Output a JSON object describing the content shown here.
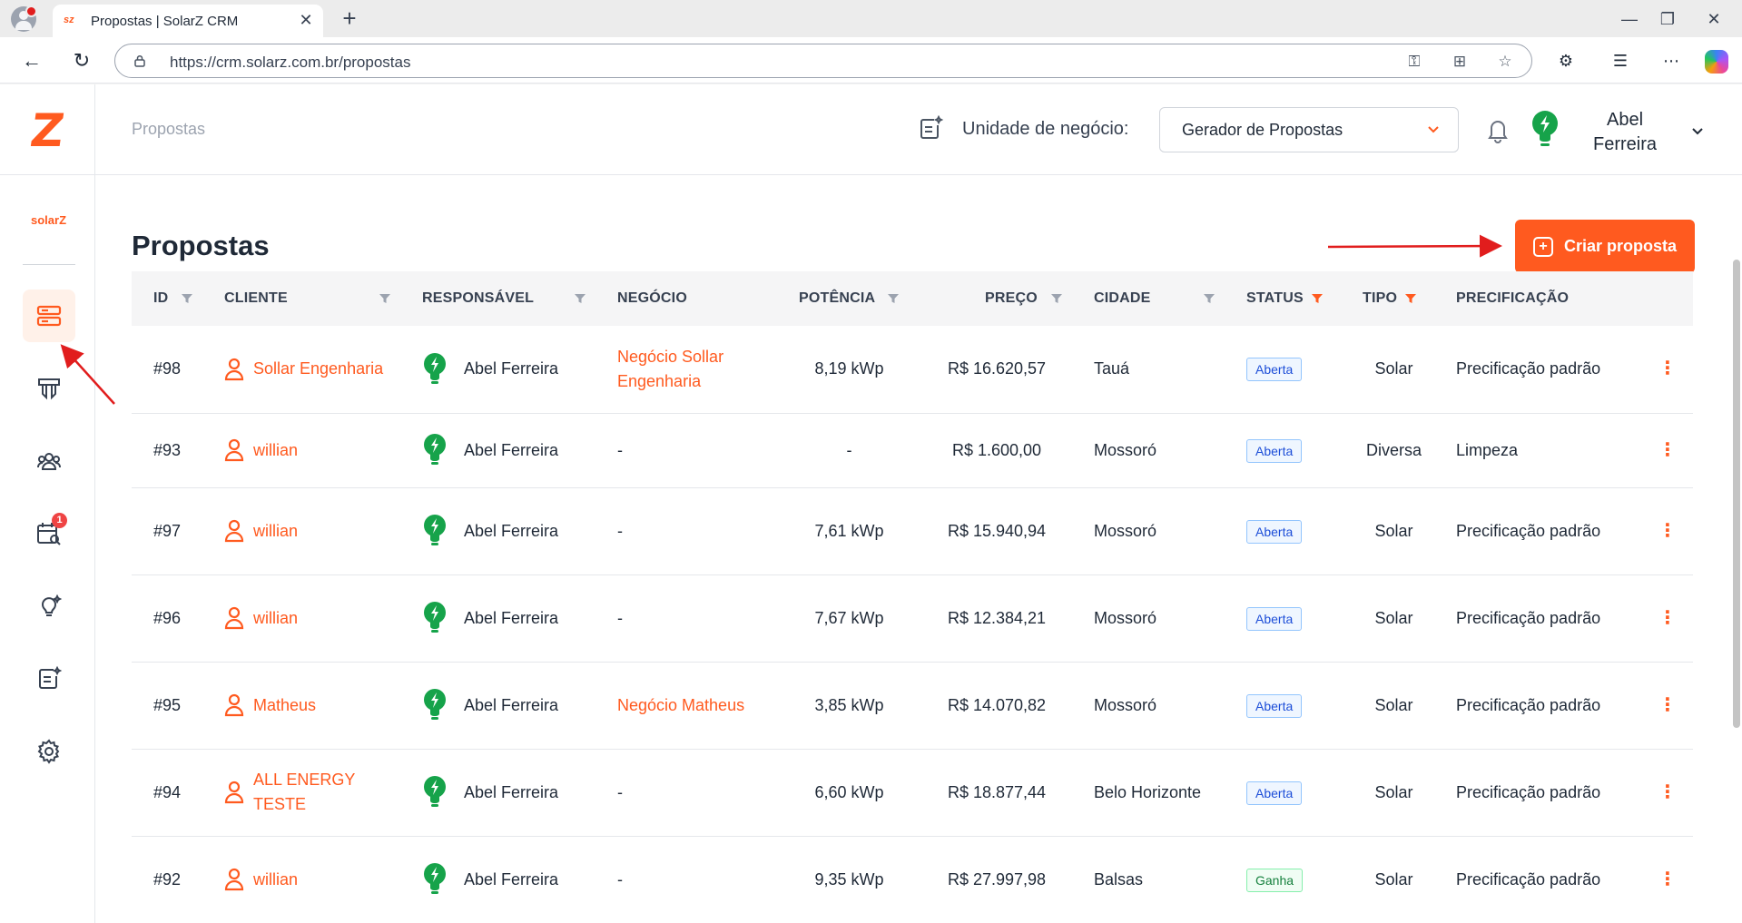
{
  "browser": {
    "tab_title": "Propostas | SolarZ CRM",
    "tab_favicon": "sz",
    "url": "https://crm.solarz.com.br/propostas"
  },
  "sidebar": {
    "logo": "Z",
    "brand": "solarZ",
    "notification_count": "1"
  },
  "topbar": {
    "breadcrumb": "Propostas",
    "business_unit_label": "Unidade de negócio:",
    "business_unit_value": "Gerador de Propostas",
    "user_first": "Abel",
    "user_last": "Ferreira"
  },
  "main": {
    "title": "Propostas",
    "create_button": "Criar proposta"
  },
  "table": {
    "headers": {
      "id": "ID",
      "cliente": "CLIENTE",
      "responsavel": "RESPONSÁVEL",
      "negocio": "NEGÓCIO",
      "potencia": "POTÊNCIA",
      "preco": "PREÇO",
      "cidade": "CIDADE",
      "status": "STATUS",
      "tipo": "TIPO",
      "precificacao": "PRECIFICAÇÃO"
    },
    "rows": [
      {
        "id": "#98",
        "cliente": "Sollar Engenharia",
        "responsavel": "Abel Ferreira",
        "negocio": "Negócio Sollar Engenharia",
        "potencia": "8,19 kWp",
        "preco": "R$ 16.620,57",
        "cidade": "Tauá",
        "status": "Aberta",
        "tipo": "Solar",
        "precificacao": "Precificação padrão"
      },
      {
        "id": "#93",
        "cliente": "willian",
        "responsavel": "Abel Ferreira",
        "negocio": "-",
        "potencia": "-",
        "preco": "R$ 1.600,00",
        "cidade": "Mossoró",
        "status": "Aberta",
        "tipo": "Diversa",
        "precificacao": "Limpeza"
      },
      {
        "id": "#97",
        "cliente": "willian",
        "responsavel": "Abel Ferreira",
        "negocio": "-",
        "potencia": "7,61 kWp",
        "preco": "R$ 15.940,94",
        "cidade": "Mossoró",
        "status": "Aberta",
        "tipo": "Solar",
        "precificacao": "Precificação padrão"
      },
      {
        "id": "#96",
        "cliente": "willian",
        "responsavel": "Abel Ferreira",
        "negocio": "-",
        "potencia": "7,67 kWp",
        "preco": "R$ 12.384,21",
        "cidade": "Mossoró",
        "status": "Aberta",
        "tipo": "Solar",
        "precificacao": "Precificação padrão"
      },
      {
        "id": "#95",
        "cliente": "Matheus",
        "responsavel": "Abel Ferreira",
        "negocio": "Negócio Matheus",
        "potencia": "3,85 kWp",
        "preco": "R$ 14.070,82",
        "cidade": "Mossoró",
        "status": "Aberta",
        "tipo": "Solar",
        "precificacao": "Precificação padrão"
      },
      {
        "id": "#94",
        "cliente": "ALL ENERGY TESTE",
        "responsavel": "Abel Ferreira",
        "negocio": "-",
        "potencia": "6,60 kWp",
        "preco": "R$ 18.877,44",
        "cidade": "Belo Horizonte",
        "status": "Aberta",
        "tipo": "Solar",
        "precificacao": "Precificação padrão"
      },
      {
        "id": "#92",
        "cliente": "willian",
        "responsavel": "Abel Ferreira",
        "negocio": "-",
        "potencia": "9,35 kWp",
        "preco": "R$ 27.997,98",
        "cidade": "Balsas",
        "status": "Ganha",
        "tipo": "Solar",
        "precificacao": "Precificação padrão"
      }
    ]
  },
  "colors": {
    "accent": "#ff5a1f",
    "status_open": "#1d4ed8",
    "status_won": "#15803d",
    "annotation_arrow": "#e11d1d"
  }
}
